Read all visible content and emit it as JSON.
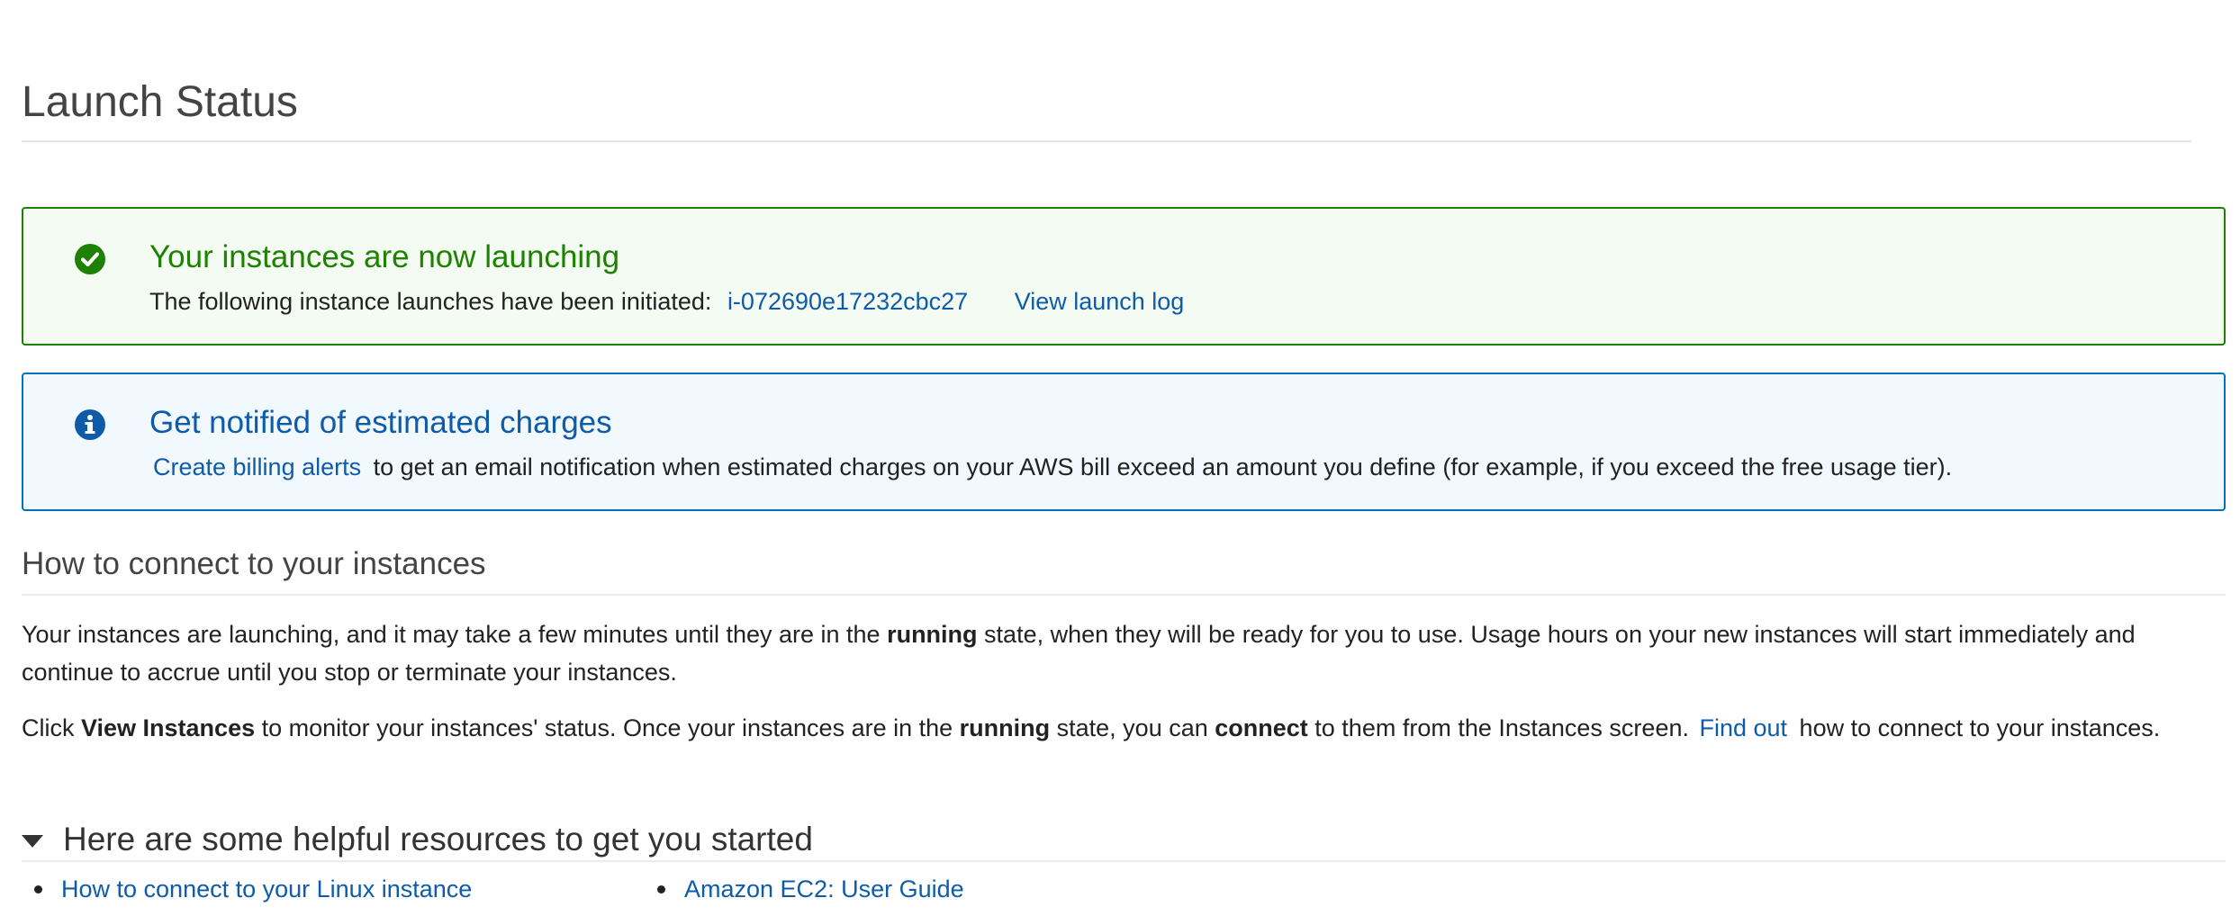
{
  "page": {
    "title": "Launch Status"
  },
  "success_alert": {
    "icon": "check-circle-icon",
    "title": "Your instances are now launching",
    "body_prefix": "The following instance launches have been initiated:",
    "instance_id": "i-072690e17232cbc27",
    "view_log_label": "View launch log",
    "color": "#1d8102"
  },
  "info_alert": {
    "icon": "info-circle-icon",
    "title": "Get notified of estimated charges",
    "link_label": "Create billing alerts",
    "body_suffix": "to get an email notification when estimated charges on your AWS bill exceed an amount you define (for example, if you exceed the free usage tier).",
    "color": "#0073bb"
  },
  "connect_section": {
    "title": "How to connect to your instances",
    "p1": {
      "t1": "Your instances are launching, and it may take a few minutes until they are in the ",
      "b1": "running",
      "t2": " state, when they will be ready for you to use. Usage hours on your new instances will start immediately and continue to accrue until you stop or terminate your instances."
    },
    "p2": {
      "t1": "Click ",
      "b1": "View Instances",
      "t2": " to monitor your instances' status. Once your instances are in the ",
      "b2": "running",
      "t3": " state, you can ",
      "b3": "connect",
      "t4": " to them from the Instances screen. ",
      "link": "Find out",
      "t5": " how to connect to your instances."
    }
  },
  "resources": {
    "title": "Here are some helpful resources to get you started",
    "col1": [
      "How to connect to your Linux instance"
    ],
    "col2": [
      "Amazon EC2: User Guide"
    ]
  }
}
